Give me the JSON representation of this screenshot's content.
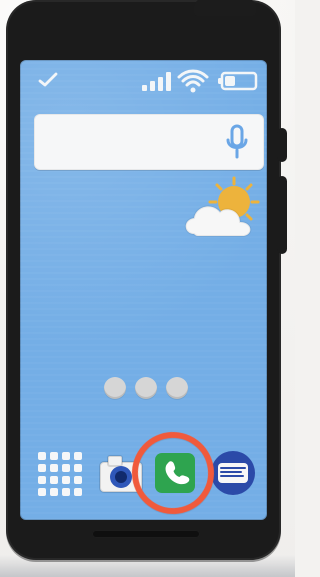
{
  "page": {
    "title": ""
  },
  "status_bar": {
    "icons": [
      "check-icon",
      "signal-icon",
      "wifi-icon",
      "battery-icon"
    ]
  },
  "search": {
    "value": "",
    "placeholder": ""
  },
  "weather": {
    "icon": "sun-cloud-icon"
  },
  "page_indicator": {
    "count": 3,
    "active_index": 0
  },
  "dock": {
    "items": [
      {
        "icon": "apps-grid-icon"
      },
      {
        "icon": "camera-icon"
      },
      {
        "icon": "phone-call-icon"
      },
      {
        "icon": "messages-icon"
      }
    ],
    "highlighted_icon": "phone-call-icon"
  },
  "colors": {
    "screen": "#74aee6",
    "phone_body": "#1b1b1b",
    "highlight": "#f05a3c",
    "phone_app_green": "#2ea44f",
    "messages_blue": "#2b4aa8"
  }
}
